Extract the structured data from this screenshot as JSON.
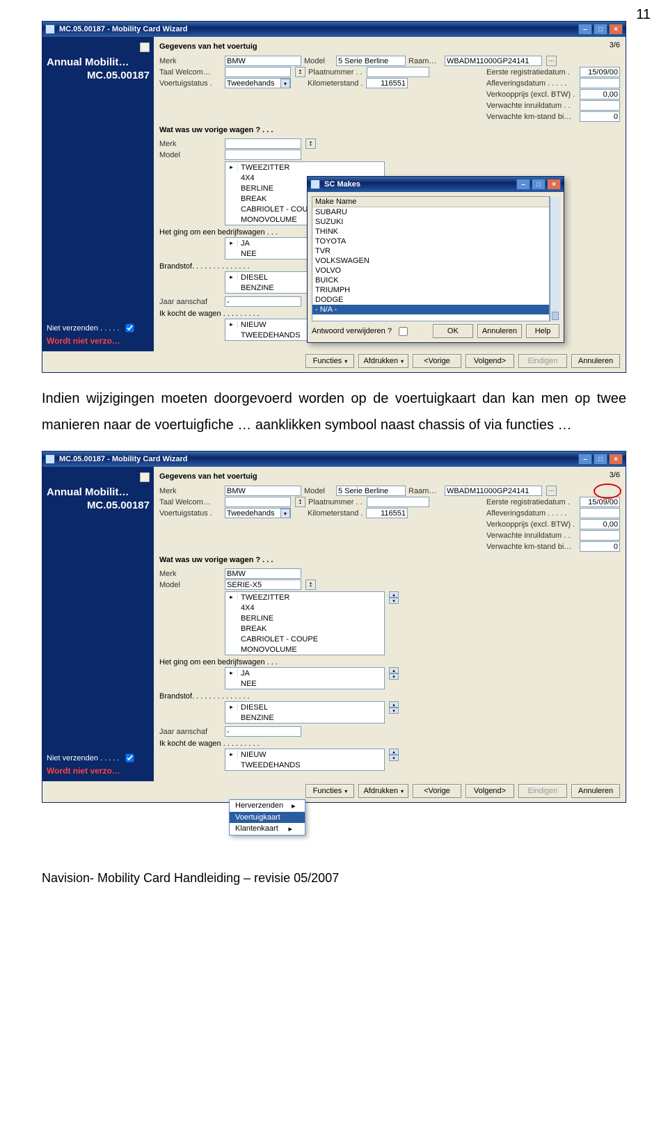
{
  "page_number": "11",
  "para1": "Indien wijzigingen moeten doorgevoerd worden op de voertuigkaart dan kan men op twee manieren naar de voertuigfiche … aanklikken symbool naast chassis of via functies …",
  "footer": "Navision- Mobility Card Handleiding – revisie 05/2007",
  "window_title": "MC.05.00187 - Mobility Card Wizard",
  "sidebar": {
    "program": "Annual Mobilit…",
    "code": "MC.05.00187",
    "niet_verzenden_label": "Niet verzenden . . . . .",
    "warn": "Wordt niet verzo…"
  },
  "section_title": "Gegevens van het voertuig",
  "step_counter": "3/6",
  "vehicle": {
    "merk_label": "Merk",
    "merk_value": "BMW",
    "model_label": "Model",
    "model_value": "5 Serie Berline",
    "raam_label": "Raam…",
    "raam_value": "WBADM11000GP24141",
    "taal_label": "Taal Welcom…",
    "plaat_label": "Plaatnummer . .",
    "plaat_value": "",
    "reg_label": "Eerste registratiedatum  .",
    "reg_value": "15/09/00",
    "status_label": "Voertuigstatus .",
    "status_value": "Tweedehands",
    "km_label": "Kilometerstand .",
    "km_value": "116551",
    "aflever_label": "Afleveringsdatum . . . . .",
    "aflever_value": "",
    "verkoop_label": "Verkoopprijs (excl. BTW) .",
    "verkoop_value": "0,00",
    "inruil_label": "Verwachte inruildatum . .",
    "inruil_value": "",
    "kmstand_label": "Verwachte km-stand bi…",
    "kmstand_value": "0"
  },
  "prev_q": "Wat was uw vorige wagen ? . . .",
  "prev_merk_label": "Merk",
  "prev_model_label": "Model",
  "prev_merk_value2": "BMW",
  "prev_model_value2": "SERIE-X5",
  "body_types": [
    "TWEEZITTER",
    "4X4",
    "BERLINE",
    "BREAK",
    "CABRIOLET - COUPE",
    "MONOVOLUME"
  ],
  "company_q": "Het ging om een bedrijfswagen  .  .  .",
  "yesno": [
    "JA",
    "NEE"
  ],
  "fuel_q": "Brandstof.  .  .  .  .  .  .  .  .  .  .  .  .  .",
  "fuels": [
    "DIESEL",
    "BENZINE"
  ],
  "jaar_label": "Jaar aanschaf",
  "jaar_value": "-",
  "kocht_q": "Ik kocht de wagen  .  .  .  .  .  .  .  .  .",
  "kocht_opts": [
    "NIEUW",
    "TWEEDEHANDS"
  ],
  "buttons": {
    "functies": "Functies",
    "afdrukken": "Afdrukken",
    "vorige": "<Vorige",
    "volgend": "Volgend>",
    "eindigen": "Eindigen",
    "annuleren": "Annuleren",
    "ok": "OK",
    "help": "Help"
  },
  "popup": {
    "title": "SC Makes",
    "header": "Make Name",
    "items": [
      "SUBARU",
      "SUZUKI",
      "THINK",
      "TOYOTA",
      "TVR",
      "VOLKSWAGEN",
      "VOLVO",
      "BUICK",
      "TRIUMPH",
      "DODGE",
      "- N/A -"
    ],
    "del_label": "Antwoord verwijderen ?"
  },
  "funcmenu": {
    "herverzenden": "Herverzenden",
    "voertuigkaart": "Voertuigkaart",
    "klantenkaart": "Klantenkaart"
  }
}
